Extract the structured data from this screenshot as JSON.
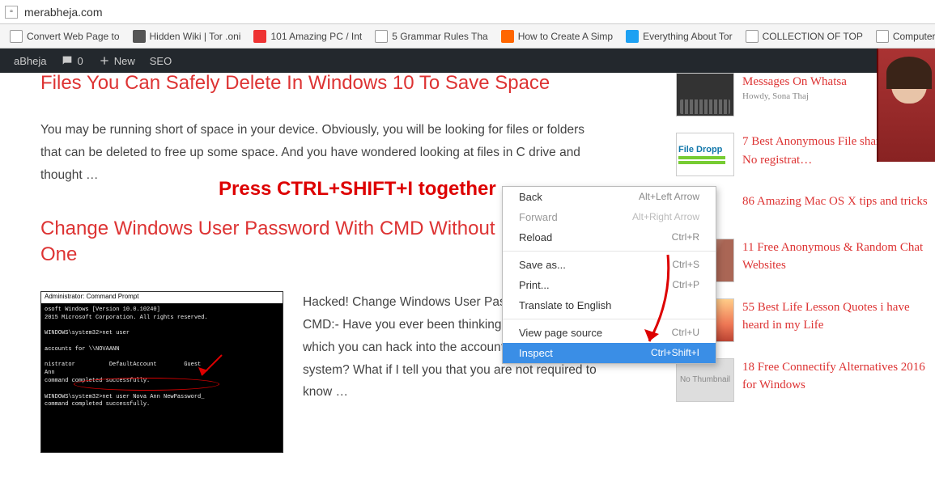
{
  "url": "merabheja.com",
  "bookmarks": [
    {
      "label": "Convert Web Page to",
      "cls": "bi-doc"
    },
    {
      "label": "Hidden Wiki | Tor .oni",
      "cls": "bi-skull"
    },
    {
      "label": "101 Amazing PC / Int",
      "cls": "bi-pc"
    },
    {
      "label": "5 Grammar Rules Tha",
      "cls": "bi-doc"
    },
    {
      "label": "How to Create A Simp",
      "cls": "bi-plus"
    },
    {
      "label": "Everything About Tor",
      "cls": "bi-b"
    },
    {
      "label": "COLLECTION OF TOP",
      "cls": "bi-doc"
    },
    {
      "label": "Computer Tricks - Sn",
      "cls": "bi-doc"
    }
  ],
  "wp": {
    "site": "aBheja",
    "comments": "0",
    "new": "New",
    "seo": "SEO"
  },
  "overlay": "Press CTRL+SHIFT+I together",
  "articles": [
    {
      "title": "Files You Can Safely Delete In Windows 10 To Save Space",
      "text": "You may be running short of space in your device. Obviously, you will be looking for files or folders that can be deleted to free up some space. And you have wondered looking at files in C drive and thought …"
    },
    {
      "title": "Change Windows User Password With CMD Without Knowing Current One",
      "text": "Hacked! Change Windows User Password With CMD:- Have you ever been thinking about ways using which you can hack into the accounts in your Windows system? What if I tell you that you are not required to know …",
      "cmd_title": "Administrator: Command Prompt",
      "cmd_lines": "osoft Windows [Version 10.0.10240]\n2015 Microsoft Corporation. All rights reserved.\n\nWINDOWS\\system32>net user\n\naccounts for \\\\NOVAANN\n\nnistrator          DefaultAccount        Guest\nAnn\ncommand completed successfully.\n\nWINDOWS\\system32>net user Nova Ann NewPassword_\ncommand completed successfully."
    }
  ],
  "ctx": [
    {
      "label": "Back",
      "sc": "Alt+Left Arrow",
      "type": "item"
    },
    {
      "label": "Forward",
      "sc": "Alt+Right Arrow",
      "type": "dis"
    },
    {
      "label": "Reload",
      "sc": "Ctrl+R",
      "type": "item"
    },
    {
      "type": "sep"
    },
    {
      "label": "Save as...",
      "sc": "Ctrl+S",
      "type": "item"
    },
    {
      "label": "Print...",
      "sc": "Ctrl+P",
      "type": "item"
    },
    {
      "label": "Translate to English",
      "sc": "",
      "type": "item"
    },
    {
      "type": "sep"
    },
    {
      "label": "View page source",
      "sc": "Ctrl+U",
      "type": "item"
    },
    {
      "label": "Inspect",
      "sc": "Ctrl+Shift+I",
      "type": "hl"
    }
  ],
  "sidebar": [
    {
      "title": "Messages On Whatsa",
      "sub": "Howdy, Sona Thaj",
      "thumb": "whats"
    },
    {
      "title": "7 Best Anonymous File sharing sites : No registrat…",
      "thumb": "file"
    },
    {
      "title": "86 Amazing Mac OS X tips and tricks",
      "thumb": "none"
    },
    {
      "title": "11 Free Anonymous & Random Chat Websites",
      "thumb": "face"
    },
    {
      "title": "55 Best Life Lesson Quotes i have heard in my Life",
      "thumb": "kids"
    },
    {
      "title": "18 Free Connectify Alternatives 2016 for Windows",
      "thumb": "nothumb"
    }
  ],
  "nothumb_text": "No\nThumbnail"
}
